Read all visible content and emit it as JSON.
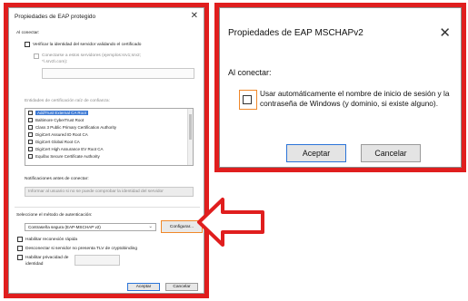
{
  "left_dialog": {
    "title": "Propiedades de EAP protegido",
    "close_glyph": "✕",
    "section_connect": "Al conectar:",
    "verify_identity": "Verificar la identidad del servidor validando el certificado",
    "connect_servers_1": "Conectarse a estos servidores (ejemplos:srv1;srv2;",
    "connect_servers_2": "*\\.srv3\\.com):",
    "trusted_roots_label": "Entidades de certificación raíz de confianza:",
    "cert_items": [
      "AddTrust External CA Root",
      "Baltimore CyberTrust Root",
      "Class 3 Public Primary Certification Authority",
      "DigiCert Assured ID Root CA",
      "DigiCert Global Root CA",
      "DigiCert High Assurance EV Root CA",
      "Equifax Secure Certificate Authority"
    ],
    "notifications_label": "Notificaciones antes de conectar:",
    "notification_value": "Informar al usuario si no se puede comprobar la identidad del servidor",
    "auth_method_label": "Seleccione el método de autenticación:",
    "auth_method_value": "Contraseña segura (EAP-MSCHAP v2)",
    "configure_button": "Configurar...",
    "fast_reconnect": "Habilitar reconexión rápida",
    "disconnect_tlv": "Desconectar si servidor no presenta TLV de cryptobinding",
    "identity_privacy_1": "Habilitar privacidad de",
    "identity_privacy_2": "identidad",
    "accept_button": "Aceptar",
    "cancel_button": "Cancelar"
  },
  "right_dialog": {
    "title": "Propiedades de EAP MSCHAPv2",
    "close_glyph": "✕",
    "when_connecting": "Al conectar:",
    "option_text": "Usar automáticamente el nombre de inicio de sesión y la contraseña de Windows (y dominio, si existe alguno).",
    "accept_button": "Aceptar",
    "cancel_button": "Cancelar"
  },
  "colors": {
    "frame_red": "#e01e1e",
    "highlight_orange": "#f0882a",
    "focus_blue": "#2b74d8",
    "selection_blue": "#3c79d4"
  },
  "icons": {
    "close": "close-icon",
    "dropdown": "chevron-down-icon",
    "pointer": "red-arrow-icon"
  }
}
